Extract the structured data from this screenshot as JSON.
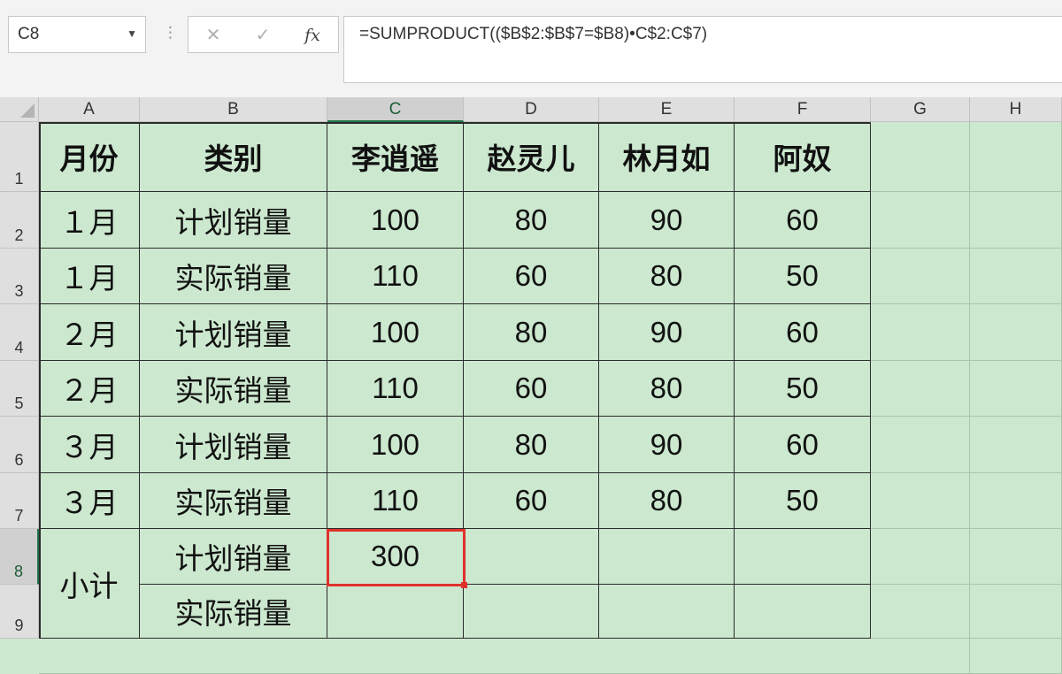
{
  "name_box": "C8",
  "formula_buttons": {
    "cancel": "✕",
    "enter": "✓",
    "fx": "fx"
  },
  "formula": "=SUMPRODUCT(($B$2:$B$7=$B8)•C$2:C$7)",
  "columns": [
    "A",
    "B",
    "C",
    "D",
    "E",
    "F",
    "G",
    "H"
  ],
  "rows": [
    "1",
    "2",
    "3",
    "4",
    "5",
    "6",
    "7",
    "8",
    "9"
  ],
  "active_cell": {
    "column": "C",
    "row": "8"
  },
  "header_row": [
    "月份",
    "类别",
    "李逍遥",
    "赵灵儿",
    "林月如",
    "阿奴"
  ],
  "data_rows": [
    [
      "１月",
      "计划销量",
      "100",
      "80",
      "90",
      "60"
    ],
    [
      "１月",
      "实际销量",
      "110",
      "60",
      "80",
      "50"
    ],
    [
      "２月",
      "计划销量",
      "100",
      "80",
      "90",
      "60"
    ],
    [
      "２月",
      "实际销量",
      "110",
      "60",
      "80",
      "50"
    ],
    [
      "３月",
      "计划销量",
      "100",
      "80",
      "90",
      "60"
    ],
    [
      "３月",
      "实际销量",
      "110",
      "60",
      "80",
      "50"
    ]
  ],
  "subtotal": {
    "label": "小计",
    "rows": [
      [
        "计划销量",
        "300",
        "",
        "",
        ""
      ],
      [
        "实际销量",
        "",
        "",
        "",
        ""
      ]
    ]
  },
  "colors": {
    "sheet_bg": "#cce8cf",
    "selection": "#e0322c",
    "header_active": "#217346"
  }
}
